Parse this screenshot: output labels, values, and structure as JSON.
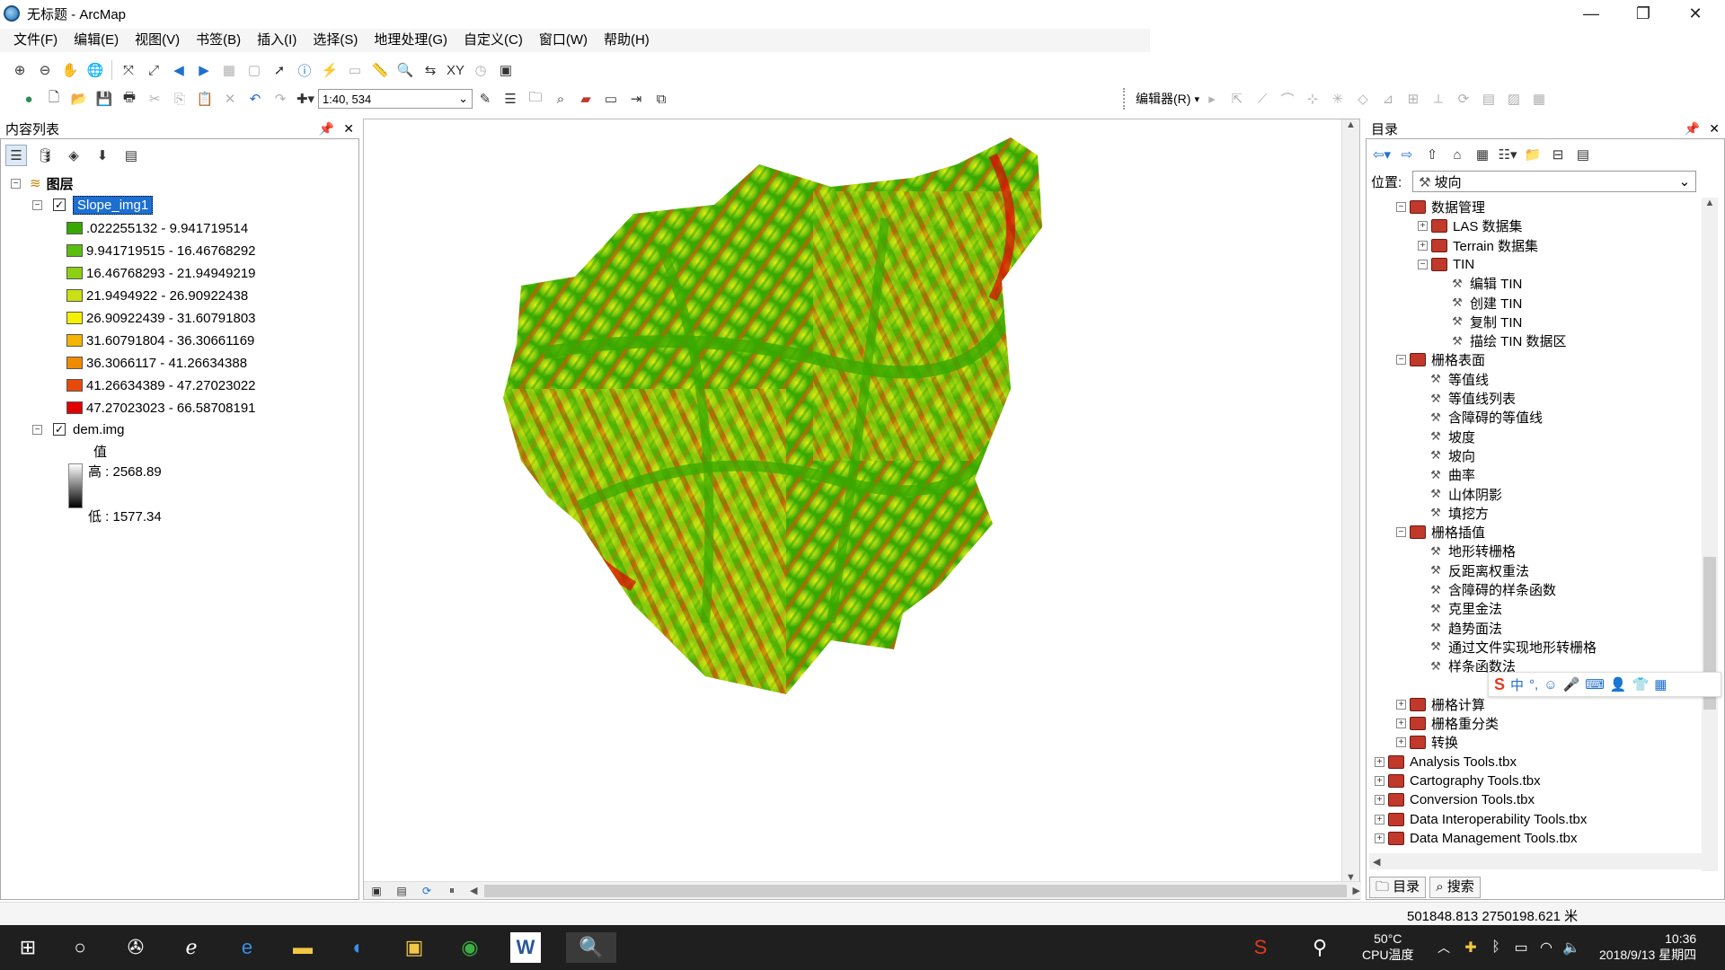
{
  "window": {
    "title": "无标题 - ArcMap"
  },
  "menu": [
    "文件(F)",
    "编辑(E)",
    "视图(V)",
    "书签(B)",
    "插入(I)",
    "选择(S)",
    "地理处理(G)",
    "自定义(C)",
    "窗口(W)",
    "帮助(H)"
  ],
  "toolbar": {
    "scale": "1:40, 534",
    "editor_label": "编辑器(R)"
  },
  "toc": {
    "title": "内容列表",
    "group_label": "图层",
    "layer1_name": "Slope_img1",
    "classes": [
      {
        "label": ".022255132 - 9.941719514",
        "color": "#38a800"
      },
      {
        "label": "9.941719515 - 16.46768292",
        "color": "#5bbf10"
      },
      {
        "label": "16.46768293 - 21.94949219",
        "color": "#8ccf14"
      },
      {
        "label": "21.9494922 - 26.90922438",
        "color": "#c8e014"
      },
      {
        "label": "26.90922439 - 31.60791803",
        "color": "#f5f000"
      },
      {
        "label": "31.60791804 - 36.30661169",
        "color": "#f5b400"
      },
      {
        "label": "36.3066117 - 41.26634388",
        "color": "#f08a00"
      },
      {
        "label": "41.26634389 - 47.27023022",
        "color": "#e84a0a"
      },
      {
        "label": "47.27023023 - 66.58708191",
        "color": "#e00000"
      }
    ],
    "layer2_name": "dem.img",
    "value_label": "值",
    "high_label": "高 : 2568.89",
    "low_label": "低 : 1577.34"
  },
  "catalog": {
    "title": "目录",
    "location_label": "位置:",
    "location_value": "坡向",
    "tree": [
      {
        "label": "数据管理",
        "type": "toolbox",
        "level": 1,
        "exp": "−"
      },
      {
        "label": "LAS 数据集",
        "type": "toolbox",
        "level": 2,
        "exp": "+"
      },
      {
        "label": "Terrain 数据集",
        "type": "toolbox",
        "level": 2,
        "exp": "+"
      },
      {
        "label": "TIN",
        "type": "toolbox",
        "level": 2,
        "exp": "−"
      },
      {
        "label": "编辑 TIN",
        "type": "tool",
        "level": 3,
        "exp": ""
      },
      {
        "label": "创建 TIN",
        "type": "tool",
        "level": 3,
        "exp": ""
      },
      {
        "label": "复制 TIN",
        "type": "tool",
        "level": 3,
        "exp": ""
      },
      {
        "label": "描绘 TIN 数据区",
        "type": "tool",
        "level": 3,
        "exp": ""
      },
      {
        "label": "栅格表面",
        "type": "toolbox",
        "level": 1,
        "exp": "−"
      },
      {
        "label": "等值线",
        "type": "tool",
        "level": 2,
        "exp": ""
      },
      {
        "label": "等值线列表",
        "type": "tool",
        "level": 2,
        "exp": ""
      },
      {
        "label": "含障碍的等值线",
        "type": "tool",
        "level": 2,
        "exp": ""
      },
      {
        "label": "坡度",
        "type": "tool",
        "level": 2,
        "exp": ""
      },
      {
        "label": "坡向",
        "type": "tool",
        "level": 2,
        "exp": ""
      },
      {
        "label": "曲率",
        "type": "tool",
        "level": 2,
        "exp": ""
      },
      {
        "label": "山体阴影",
        "type": "tool",
        "level": 2,
        "exp": ""
      },
      {
        "label": "填挖方",
        "type": "tool",
        "level": 2,
        "exp": ""
      },
      {
        "label": "栅格插值",
        "type": "toolbox",
        "level": 1,
        "exp": "−"
      },
      {
        "label": "地形转栅格",
        "type": "tool",
        "level": 2,
        "exp": ""
      },
      {
        "label": "反距离权重法",
        "type": "tool",
        "level": 2,
        "exp": ""
      },
      {
        "label": "含障碍的样条函数",
        "type": "tool",
        "level": 2,
        "exp": ""
      },
      {
        "label": "克里金法",
        "type": "tool",
        "level": 2,
        "exp": ""
      },
      {
        "label": "趋势面法",
        "type": "tool",
        "level": 2,
        "exp": ""
      },
      {
        "label": "通过文件实现地形转栅格",
        "type": "tool",
        "level": 2,
        "exp": ""
      },
      {
        "label": "样条函数法",
        "type": "tool",
        "level": 2,
        "exp": ""
      },
      {
        "label": "",
        "type": "blank",
        "level": 2,
        "exp": ""
      },
      {
        "label": "栅格计算",
        "type": "toolbox",
        "level": 1,
        "exp": "+"
      },
      {
        "label": "栅格重分类",
        "type": "toolbox",
        "level": 1,
        "exp": "+"
      },
      {
        "label": "转换",
        "type": "toolbox",
        "level": 1,
        "exp": "+"
      },
      {
        "label": "Analysis Tools.tbx",
        "type": "toolbox",
        "level": 0,
        "exp": "+"
      },
      {
        "label": "Cartography Tools.tbx",
        "type": "toolbox",
        "level": 0,
        "exp": "+"
      },
      {
        "label": "Conversion Tools.tbx",
        "type": "toolbox",
        "level": 0,
        "exp": "+"
      },
      {
        "label": "Data Interoperability Tools.tbx",
        "type": "toolbox",
        "level": 0,
        "exp": "+"
      },
      {
        "label": "Data Management Tools.tbx",
        "type": "toolbox",
        "level": 0,
        "exp": "+"
      }
    ],
    "tab_catalog": "目录",
    "tab_search": "搜索"
  },
  "ime": {
    "lang": "中"
  },
  "status": {
    "coords": "501848.813  2750198.621 米"
  },
  "taskbar": {
    "temp_value": "50°C",
    "temp_label": "CPU温度",
    "time": "10:36",
    "date": "2018/9/13 星期四"
  }
}
